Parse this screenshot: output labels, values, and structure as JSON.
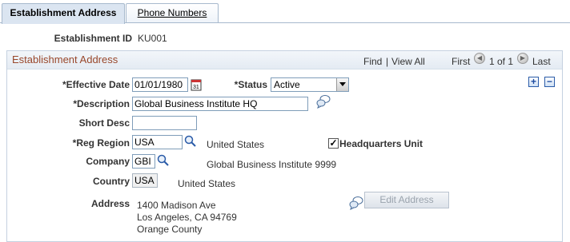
{
  "tabs": [
    {
      "label": "Establishment Address",
      "active": true
    },
    {
      "label": "Phone Numbers",
      "active": false
    }
  ],
  "header": {
    "id_label": "Establishment ID",
    "id_value": "KU001"
  },
  "group": {
    "title": "Establishment Address",
    "find": "Find",
    "separator": "|",
    "view_all": "View All",
    "first": "First",
    "range": "1 of 1",
    "last": "Last"
  },
  "form": {
    "effective_date_label": "*Effective Date",
    "effective_date_value": "01/01/1980",
    "status_label": "*Status",
    "status_value": "Active",
    "description_label": "*Description",
    "description_value": "Global Business Institute HQ",
    "short_desc_label": "Short Desc",
    "short_desc_value": "",
    "reg_region_label": "*Reg Region",
    "reg_region_value": "USA",
    "reg_region_desc": "United States",
    "hq_unit_label": "Headquarters Unit",
    "hq_unit_checked": true,
    "company_label": "Company",
    "company_value": "GBI",
    "company_desc": "Global Business Institute 9999",
    "country_label": "Country",
    "country_value": "USA",
    "country_desc": "United States",
    "address_label": "Address",
    "address_lines": [
      "1400 Madison Ave",
      "Los Angeles, CA 94769",
      "Orange County"
    ],
    "edit_address_button": "Edit Address",
    "add_row": "+",
    "delete_row": "−"
  },
  "colors": {
    "group_title": "#99472b",
    "link": "#1a3d8f",
    "tab_active_bg": "#dbe5f1"
  }
}
